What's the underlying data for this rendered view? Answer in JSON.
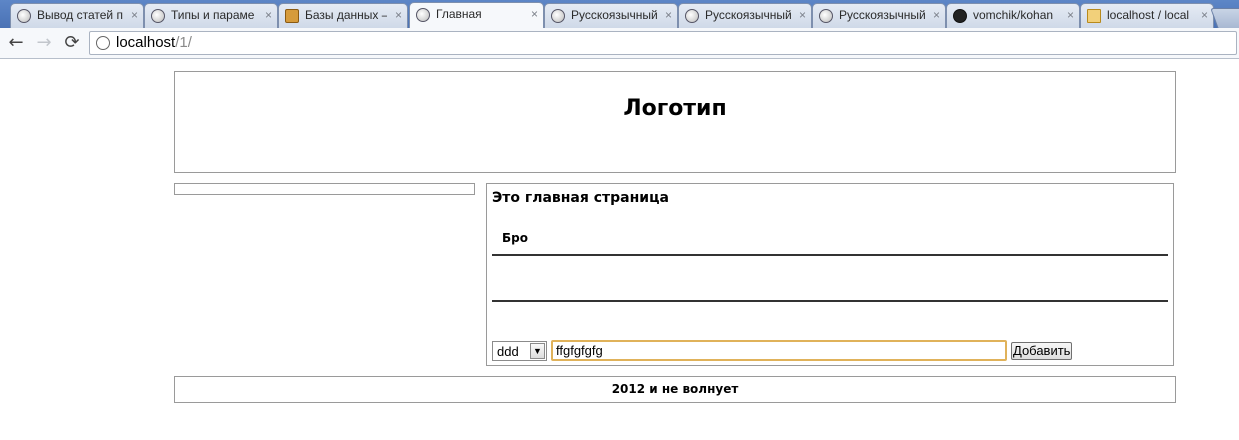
{
  "browser": {
    "tabs": [
      {
        "label": "Вывод статей п",
        "icon": "globe-icon"
      },
      {
        "label": "Типы и параме",
        "icon": "globe-icon"
      },
      {
        "label": "Базы данных —",
        "icon": "database-icon"
      },
      {
        "label": "Главная",
        "icon": "globe-icon",
        "active": true
      },
      {
        "label": "Русскоязычный",
        "icon": "globe-icon"
      },
      {
        "label": "Русскоязычный",
        "icon": "globe-icon"
      },
      {
        "label": "Русскоязычный",
        "icon": "globe-icon"
      },
      {
        "label": "vomchik/kohan",
        "icon": "github-icon"
      },
      {
        "label": "localhost / local",
        "icon": "phpmyadmin-icon"
      }
    ],
    "close_glyph": "×",
    "nav": {
      "back": "←",
      "forward": "→",
      "reload": "⟳"
    },
    "url": {
      "host": "localhost",
      "path": "/1/"
    }
  },
  "page": {
    "logo": "Логотип",
    "main_title": "Это главная страница",
    "row_label": "Бро",
    "select": {
      "value": "ddd",
      "arrow": "▼"
    },
    "input": {
      "value": "ffgfgfgfg"
    },
    "add_button": "Добавить",
    "footer": "2012 и не волнует"
  }
}
